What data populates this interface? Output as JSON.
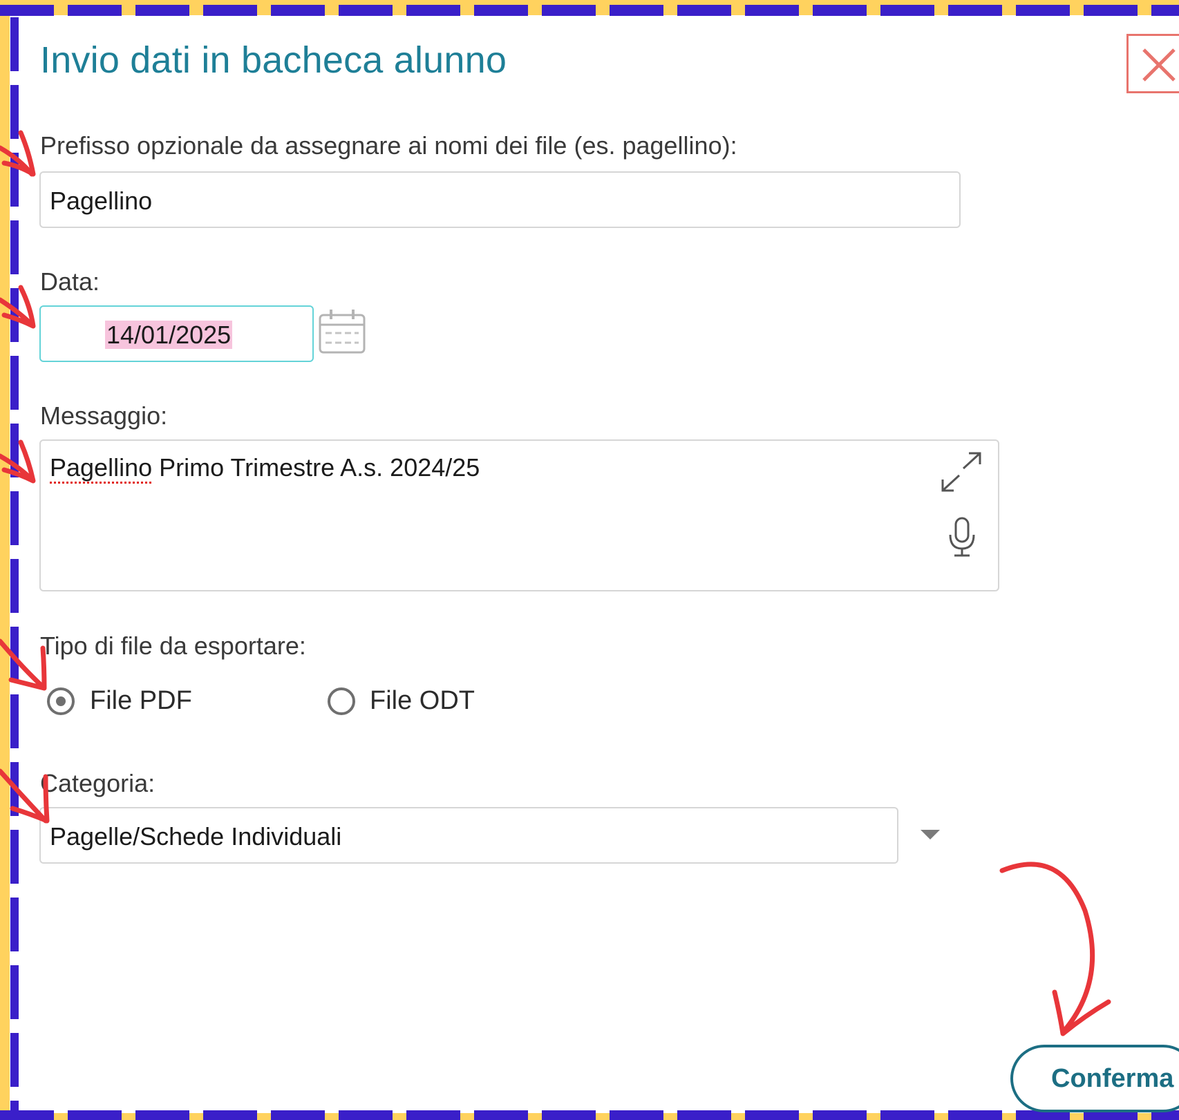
{
  "dialog": {
    "title": "Invio dati in bacheca alunno",
    "close_icon": "close-icon"
  },
  "prefix": {
    "label": "Prefisso opzionale da assegnare ai nomi dei file (es. pagellino):",
    "value": "Pagellino"
  },
  "date": {
    "label": "Data:",
    "value": "14/01/2025",
    "icon": "calendar-icon"
  },
  "message": {
    "label": "Messaggio:",
    "value_misspelled_word": "Pagellino",
    "value_rest": " Primo Trimestre A.s. 2024/25",
    "icons": [
      "expand-icon",
      "microphone-icon"
    ]
  },
  "file_type": {
    "label": "Tipo di file da esportare:",
    "options": [
      {
        "label": "File PDF",
        "checked": true
      },
      {
        "label": "File ODT",
        "checked": false
      }
    ]
  },
  "category": {
    "label": "Categoria:",
    "value": "Pagelle/Schede Individuali",
    "icon": "chevron-down-icon"
  },
  "actions": {
    "confirm_label": "Conferma"
  },
  "colors": {
    "frame_background": "#ffd25e",
    "dashed_border": "#3a1fc9",
    "title": "#1e7f97",
    "close": "#e8746d",
    "annotation_arrow": "#e8363a",
    "date_highlight": "#f7c4dd",
    "date_border": "#64d3d8",
    "confirm": "#1c6e83"
  }
}
